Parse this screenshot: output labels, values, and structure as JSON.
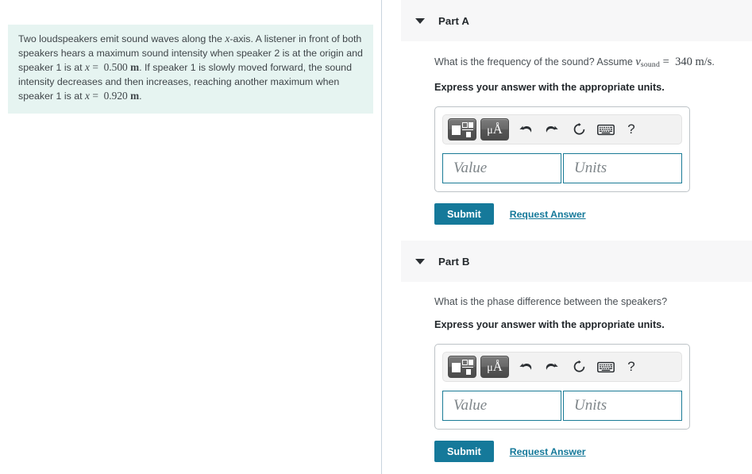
{
  "problem": {
    "text_segments": [
      {
        "t": "plain",
        "v": "Two loudspeakers emit sound waves along the "
      },
      {
        "t": "italic",
        "v": "x"
      },
      {
        "t": "plain",
        "v": "-axis. A listener in front of both speakers hears a maximum sound intensity when speaker 2 is at the origin and speaker 1 is at "
      },
      {
        "t": "italic",
        "v": "x"
      },
      {
        "t": "eq",
        "v": " = "
      },
      {
        "t": "num",
        "v": "0.500"
      },
      {
        "t": "unit",
        "v": "m"
      },
      {
        "t": "plain",
        "v": ". If speaker 1 is slowly moved forward, the sound intensity decreases and then increases, reaching another maximum when speaker 1 is at "
      },
      {
        "t": "italic",
        "v": "x"
      },
      {
        "t": "eq",
        "v": " = "
      },
      {
        "t": "num",
        "v": "0.920"
      },
      {
        "t": "unit",
        "v": "m"
      },
      {
        "t": "plain",
        "v": "."
      }
    ],
    "full_text": "Two loudspeakers emit sound waves along the x-axis. A listener in front of both speakers hears a maximum sound intensity when speaker 2 is at the origin and speaker 1 is at x = 0.500 m . If speaker 1 is slowly moved forward, the sound intensity decreases and then increases, reaching another maximum when speaker 1 is at x = 0.920 m .",
    "background_color": "#e6f4f1"
  },
  "colors": {
    "accent_teal": "#15799a",
    "field_border_teal": "#1a7b96",
    "header_band": "#f7f7f8",
    "problem_box": "#e6f4f1"
  },
  "parts": [
    {
      "id": "a",
      "title": "Part A",
      "disclosure_icon": "triangle-down-icon",
      "question_prefix": "What is the frequency of the sound? Assume ",
      "question_math_symbol": "v",
      "question_math_subscript": "sound",
      "question_math_equals": "=",
      "question_math_value": "340 m/s",
      "question_suffix": ".",
      "express_instruction": "Express your answer with the appropriate units.",
      "toolbar": {
        "template_button": "template-icon",
        "units_button": "μÅ",
        "units_button_mu": "μ",
        "units_button_angstrom": "Å",
        "undo": "undo-icon",
        "redo": "redo-icon",
        "reset": "reset-icon",
        "keyboard": "keyboard-icon",
        "help": "?"
      },
      "value_placeholder": "Value",
      "units_placeholder": "Units",
      "value_text": "",
      "units_text": "",
      "submit_label": "Submit",
      "request_answer_label": "Request Answer"
    },
    {
      "id": "b",
      "title": "Part B",
      "disclosure_icon": "triangle-down-icon",
      "question_prefix": "What is the phase difference between the speakers?",
      "question_math_symbol": "",
      "question_math_subscript": "",
      "question_math_equals": "",
      "question_math_value": "",
      "question_suffix": "",
      "express_instruction": "Express your answer with the appropriate units.",
      "toolbar": {
        "template_button": "template-icon",
        "units_button": "μÅ",
        "units_button_mu": "μ",
        "units_button_angstrom": "Å",
        "undo": "undo-icon",
        "redo": "redo-icon",
        "reset": "reset-icon",
        "keyboard": "keyboard-icon",
        "help": "?"
      },
      "value_placeholder": "Value",
      "units_placeholder": "Units",
      "value_text": "",
      "units_text": "",
      "submit_label": "Submit",
      "request_answer_label": "Request Answer"
    }
  ]
}
